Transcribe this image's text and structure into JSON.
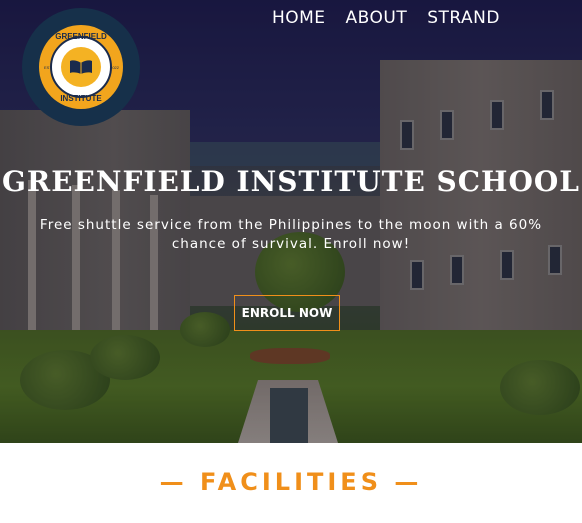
{
  "nav": {
    "items": [
      {
        "label": "HOME"
      },
      {
        "label": "ABOUT"
      },
      {
        "label": "STRAND"
      }
    ]
  },
  "logo": {
    "top_text": "GREENFIELD",
    "bottom_text": "INSTITUTE",
    "est_left": "EST",
    "est_right": "2022",
    "ring_color": "#f2a51d",
    "badge_color": "#16304a"
  },
  "hero": {
    "title": "GREENFIELD INSTITUTE SCHOOL",
    "subtitle": "Free shuttle service from the Philippines to the moon with a 60% chance of survival. Enroll now!",
    "cta_label": "ENROLL NOW",
    "cta_border_color": "#f08f1a"
  },
  "sections": {
    "facilities_heading": "— FACILITIES —",
    "accent_color": "#f08f1a"
  }
}
